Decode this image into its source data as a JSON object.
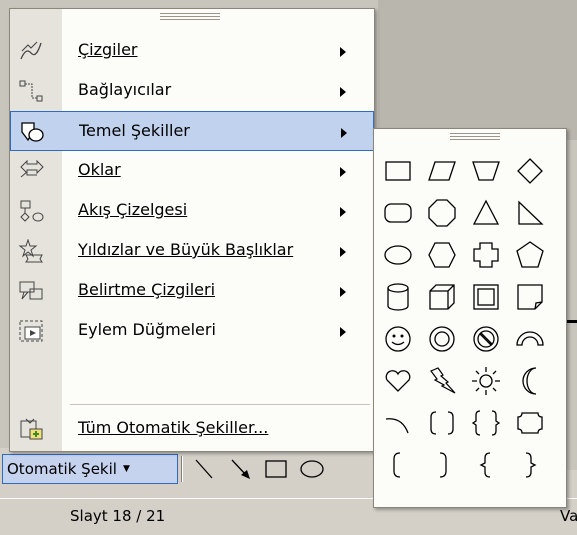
{
  "menu": {
    "items": [
      {
        "label": "Çizgiler",
        "icon": "lines-icon",
        "submenu": true
      },
      {
        "label": "Bağlayıcılar",
        "icon": "connectors-icon",
        "submenu": true
      },
      {
        "label": "Temel Şekiller",
        "icon": "basic-shapes-icon",
        "submenu": true,
        "highlighted": true
      },
      {
        "label": "Oklar",
        "icon": "block-arrows-icon",
        "submenu": true
      },
      {
        "label": "Akış Çizelgesi",
        "icon": "flowchart-icon",
        "submenu": true
      },
      {
        "label": "Yıldızlar ve Büyük Başlıklar",
        "icon": "stars-banners-icon",
        "submenu": true
      },
      {
        "label": "Belirtme Çizgileri",
        "icon": "callouts-icon",
        "submenu": true
      },
      {
        "label": "Eylem Düğmeleri",
        "icon": "action-buttons-icon",
        "submenu": true
      },
      {
        "label": "Tüm Otomatik Şekiller...",
        "icon": "more-autoshapes-icon",
        "submenu": false
      }
    ]
  },
  "submenu": {
    "title": "Temel Şekiller",
    "shapes": [
      "rectangle",
      "parallelogram",
      "trapezoid",
      "diamond",
      "rounded-rectangle",
      "octagon",
      "isosceles-triangle",
      "right-triangle",
      "oval",
      "hexagon",
      "cross",
      "pentagon",
      "can",
      "cube",
      "bevel",
      "folded-corner",
      "smiley-face",
      "donut",
      "no-symbol",
      "block-arc",
      "heart",
      "lightning-bolt",
      "sun",
      "moon",
      "arc",
      "double-bracket",
      "double-brace",
      "plaque",
      "left-bracket",
      "right-bracket",
      "left-brace",
      "right-brace"
    ]
  },
  "drawbar": {
    "autoshapes_label": "Otomatik Şekil",
    "tools": [
      "line-tool",
      "arrow-tool",
      "rectangle-tool",
      "oval-tool"
    ]
  },
  "status": {
    "slide": "Slayt 18 / 21",
    "view": "Var"
  },
  "colors": {
    "highlight": "#c1d2ee",
    "highlight_border": "#316ac5",
    "menu_bg": "#fcfcf9",
    "strip": "#e5e3dc"
  }
}
